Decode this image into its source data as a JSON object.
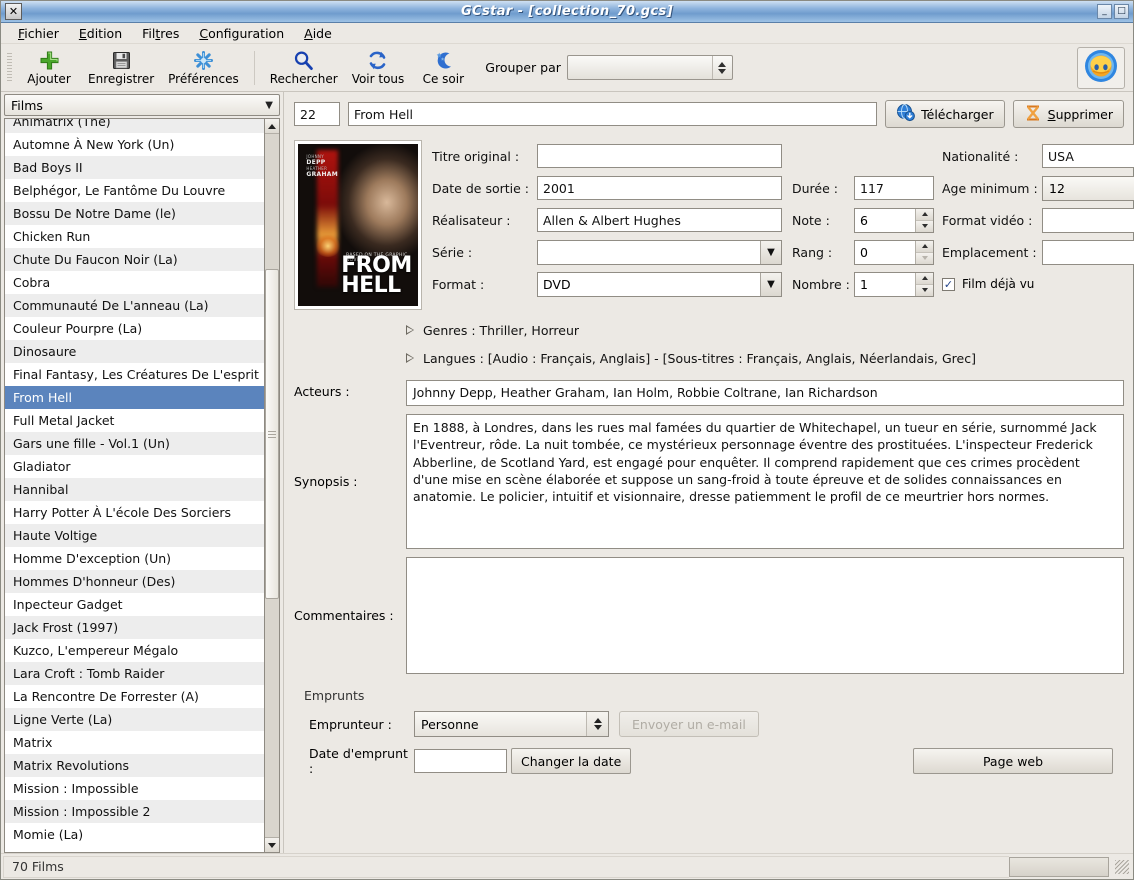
{
  "window": {
    "title": "GCstar - [collection_70.gcs]",
    "close_icon": "✕",
    "minimize_icon": "_",
    "maximize_icon": "□"
  },
  "menubar": {
    "items": [
      {
        "pre": "F",
        "mn": "",
        "label": "Fichier",
        "m_index": 0
      },
      {
        "label": "Edition",
        "m_index": 0
      },
      {
        "label": "Filtres",
        "m_index": 4
      },
      {
        "label": "Configuration",
        "m_index": 0
      },
      {
        "label": "Aide",
        "m_index": 0
      }
    ]
  },
  "toolbar": {
    "tools": [
      {
        "label": "Ajouter",
        "icon": "plus-icon"
      },
      {
        "label": "Enregistrer",
        "icon": "save-floppy-icon"
      },
      {
        "label": "Préférences",
        "icon": "snowflake-icon"
      },
      {
        "label": "Rechercher",
        "icon": "magnifier-icon"
      },
      {
        "label": "Voir tous",
        "icon": "refresh-icon"
      },
      {
        "label": "Ce soir",
        "icon": "moon-stars-icon"
      }
    ],
    "group_label": "Grouper par",
    "group_value": "",
    "far_button_icon": "smiley-face-icon"
  },
  "sidebar": {
    "category": "Films",
    "items": [
      "Animatrix (The)",
      "Automne À New York (Un)",
      "Bad Boys II",
      "Belphégor, Le Fantôme Du Louvre",
      "Bossu De Notre Dame (le)",
      "Chicken Run",
      "Chute Du Faucon Noir (La)",
      "Cobra",
      "Communauté De L'anneau (La)",
      "Couleur Pourpre (La)",
      "Dinosaure",
      "Final Fantasy, Les Créatures De L'esprit",
      "From Hell",
      "Full Metal Jacket",
      "Gars une fille - Vol.1  (Un)",
      "Gladiator",
      "Hannibal",
      "Harry Potter À L'école Des Sorciers",
      "Haute Voltige",
      "Homme D'exception (Un)",
      "Hommes D'honneur (Des)",
      "Inpecteur Gadget",
      "Jack Frost (1997)",
      "Kuzco, L'empereur Mégalo",
      "Lara Croft : Tomb Raider",
      "La Rencontre De Forrester (A)",
      "Ligne Verte (La)",
      "Matrix",
      "Matrix Revolutions",
      "Mission : Impossible",
      "Mission : Impossible 2",
      "Momie (La)"
    ],
    "selected": "From Hell",
    "selected_color": "#5b84bd"
  },
  "record": {
    "id": "22",
    "title": "From Hell",
    "download_button": "Télécharger",
    "delete_button": "Supprimer",
    "poster": {
      "actor1": "JOHNNY",
      "actor1_sub": "DEPP",
      "actor2": "HEATHER",
      "actor2_sub": "GRAHAM",
      "small_credit": "BASED ON THE GRAPHIC NOVEL",
      "title_line1": "FROM",
      "title_line2": "HELL"
    },
    "fields": {
      "titre_original_label": "Titre original :",
      "titre_original_value": "",
      "date_sortie_label": "Date de sortie :",
      "date_sortie_value": "2001",
      "realisateur_label": "Réalisateur :",
      "realisateur_value": "Allen & Albert Hughes",
      "serie_label": "Série :",
      "serie_value": "",
      "format_label": "Format :",
      "format_value": "DVD",
      "duree_label": "Durée :",
      "duree_value": "117",
      "note_label": "Note :",
      "note_value": "6",
      "rang_label": "Rang :",
      "rang_value": "0",
      "nombre_label": "Nombre :",
      "nombre_value": "1",
      "nationalite_label": "Nationalité :",
      "nationalite_value": "USA",
      "age_minimum_label": "Age minimum :",
      "age_minimum_value": "12",
      "format_video_label": "Format vidéo :",
      "format_video_value": "",
      "emplacement_label": "Emplacement :",
      "emplacement_value": "",
      "film_deja_vu_label": "Film déjà vu",
      "film_deja_vu_checked": "✓"
    },
    "expanders": {
      "genres": "Genres : Thriller, Horreur",
      "langues": "Langues : [Audio : Français, Anglais] - [Sous-titres : Français, Anglais, Néerlandais, Grec]"
    },
    "acteurs_label": "Acteurs :",
    "acteurs_value": "Johnny Depp, Heather Graham, Ian Holm, Robbie Coltrane, Ian Richardson",
    "synopsis_label": "Synopsis :",
    "synopsis_value": "En 1888, à Londres, dans les rues mal famées du quartier de Whitechapel, un tueur en série, surnommé Jack l'Eventreur, rôde. La nuit tombée, ce mystérieux personnage éventre des prostituées. L'inspecteur Frederick Abberline, de Scotland Yard, est engagé pour enquêter. Il comprend rapidement que ces crimes procèdent d'une mise en scène élaborée et suppose un sang-froid à toute épreuve et de solides connaissances en anatomie. Le policier, intuitif et visionnaire, dresse patiemment le profil de ce meurtrier hors normes.",
    "commentaires_label": "Commentaires :",
    "commentaires_value": ""
  },
  "emprunts": {
    "section_title": "Emprunts",
    "emprunteur_label": "Emprunteur :",
    "emprunteur_value": "Personne",
    "email_button": "Envoyer un e-mail",
    "date_label": "Date d'emprunt :",
    "date_value": "",
    "change_date_button": "Changer la date",
    "page_web_button": "Page web"
  },
  "statusbar": {
    "text": "70 Films"
  }
}
